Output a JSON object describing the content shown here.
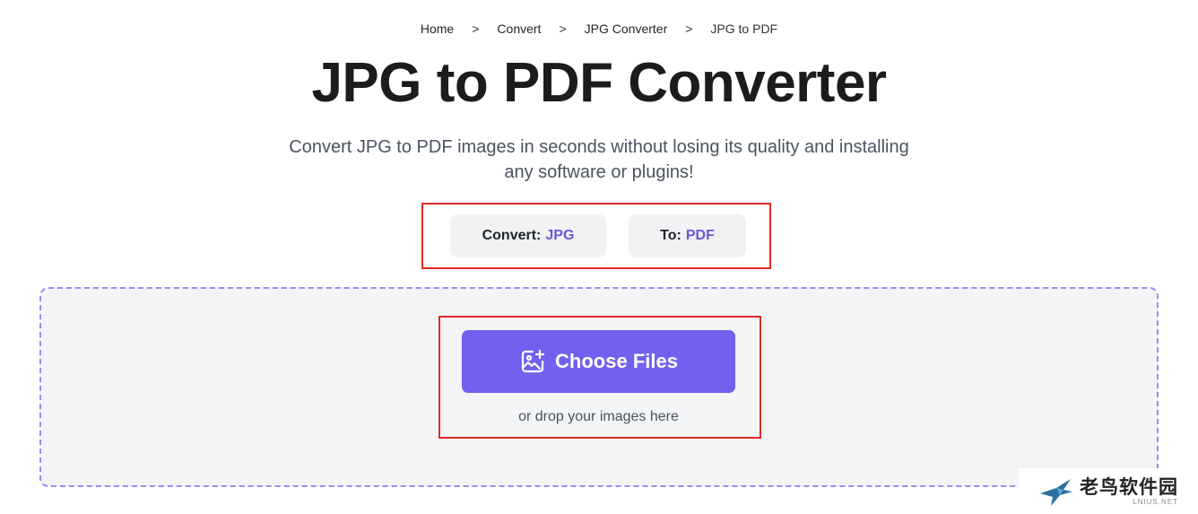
{
  "breadcrumb": {
    "items": [
      "Home",
      "Convert",
      "JPG Converter"
    ],
    "separator": ">",
    "current": "JPG to PDF"
  },
  "header": {
    "title": "JPG to PDF Converter",
    "subtitle": "Convert JPG to PDF images in seconds without losing its quality and installing any software or plugins!"
  },
  "format": {
    "from_label": "Convert:",
    "from_value": "JPG",
    "to_label": "To:",
    "to_value": "PDF"
  },
  "upload": {
    "button_label": "Choose Files",
    "button_icon": "image-add-icon",
    "hint": "or drop your images here"
  },
  "watermark": {
    "cn_text": "老鸟软件园",
    "en_text": "LNIUS.NET",
    "logo_icon": "bird-logo-icon"
  },
  "colors": {
    "accent": "#7360ee",
    "highlight_border": "#e12a22",
    "format_value": "#6b56d6",
    "dropzone_border": "#9b8cf0"
  }
}
